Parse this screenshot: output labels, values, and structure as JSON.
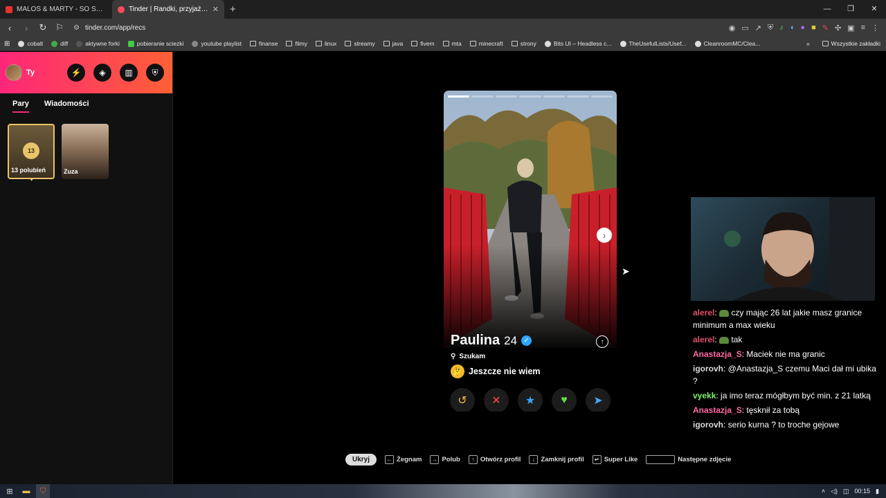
{
  "browser": {
    "tabs": [
      {
        "title": "MALOS & MARTY - SO SWEET (R",
        "active": false,
        "color": "#e8322d"
      },
      {
        "title": "Tinder | Randki, przyjaźni, nowe z",
        "active": true,
        "color": "#fd4c5c"
      }
    ],
    "new_tab": "+",
    "url": "tinder.com/app/recs",
    "bookmarks": [
      {
        "label": "cobalt",
        "icon": "cobalt-icon"
      },
      {
        "label": "diff",
        "icon": "diff-icon"
      },
      {
        "label": "aktywne forki",
        "icon": "fork-icon"
      },
      {
        "label": "pobieranie sciezki",
        "icon": "download-icon"
      },
      {
        "label": "youtube playlist",
        "icon": "globe-icon"
      },
      {
        "label": "finanse",
        "icon": "folder-icon"
      },
      {
        "label": "filmy",
        "icon": "folder-icon"
      },
      {
        "label": "linux",
        "icon": "folder-icon"
      },
      {
        "label": "streamy",
        "icon": "folder-icon"
      },
      {
        "label": "java",
        "icon": "folder-icon"
      },
      {
        "label": "fivem",
        "icon": "folder-icon"
      },
      {
        "label": "mta",
        "icon": "folder-icon"
      },
      {
        "label": "minecraft",
        "icon": "folder-icon"
      },
      {
        "label": "strony",
        "icon": "folder-icon"
      },
      {
        "label": "Bits UI – Headless c...",
        "icon": "globe-icon"
      },
      {
        "label": "TheUsefulLists/Usef...",
        "icon": "github-icon"
      },
      {
        "label": "CleanroomMC/Clea...",
        "icon": "github-icon"
      }
    ],
    "bookmarks_overflow": "»",
    "all_bookmarks": "Wszystkie zakładki"
  },
  "sidebar": {
    "user_name": "Ty",
    "tabs": [
      {
        "label": "Pary",
        "active": true
      },
      {
        "label": "Wiadomości",
        "active": false
      }
    ],
    "likes": {
      "count": "13",
      "label": "13 polubień"
    },
    "matches": [
      {
        "name": "Zuza"
      }
    ]
  },
  "profile": {
    "name": "Paulina",
    "age": "24",
    "verified": true,
    "seeking_label": "Szukam",
    "goal_emoji": "🤔",
    "goal": "Jeszcze nie wiem",
    "photo_count": 7,
    "current_photo": 1
  },
  "actions": [
    {
      "name": "rewind",
      "icon": "↺",
      "color": "#f5b748"
    },
    {
      "name": "nope",
      "icon": "✕",
      "color": "#ff4458"
    },
    {
      "name": "super-like",
      "icon": "★",
      "color": "#3ca4ff"
    },
    {
      "name": "like",
      "icon": "♥",
      "color": "#66dd44"
    },
    {
      "name": "boost",
      "icon": "➤",
      "color": "#4da6ff"
    }
  ],
  "chat": [
    {
      "user": "alerel",
      "color": "#e0506a",
      "text": "czy mając 26 lat jakie masz granice minimum a max wieku",
      "emote": true
    },
    {
      "user": "alerel",
      "color": "#e0506a",
      "text": "tak",
      "emote": true
    },
    {
      "user": "Anastazja_S",
      "color": "#ff6aa6",
      "text": "Maciek nie ma granic",
      "emote": false
    },
    {
      "user": "igorovh",
      "color": "#dcdcdc",
      "text": "@Anastazja_S czemu Maci dał mi ubika ?",
      "emote": false
    },
    {
      "user": "vyekk",
      "color": "#7cf46a",
      "text": "ja imo teraz mógłbym być min. z 21 latką",
      "emote": false
    },
    {
      "user": "Anastazja_S",
      "color": "#ff6aa6",
      "text": "tęsknił za tobą",
      "emote": false
    },
    {
      "user": "igorovh",
      "color": "#dcdcdc",
      "text": "serio kurna ? to troche gejowe",
      "emote": false
    }
  ],
  "hotkeys": {
    "hide": "Ukryj",
    "items": [
      {
        "key": "←",
        "label": "Żegnam"
      },
      {
        "key": "→",
        "label": "Polub"
      },
      {
        "key": "↑",
        "label": "Otwórz profil"
      },
      {
        "key": "↓",
        "label": "Zamknij profil"
      },
      {
        "key": "↵",
        "label": "Super Like"
      },
      {
        "key": "",
        "label": "Następne zdjęcie",
        "wide": true
      }
    ]
  },
  "taskbar": {
    "time": "00:15"
  }
}
